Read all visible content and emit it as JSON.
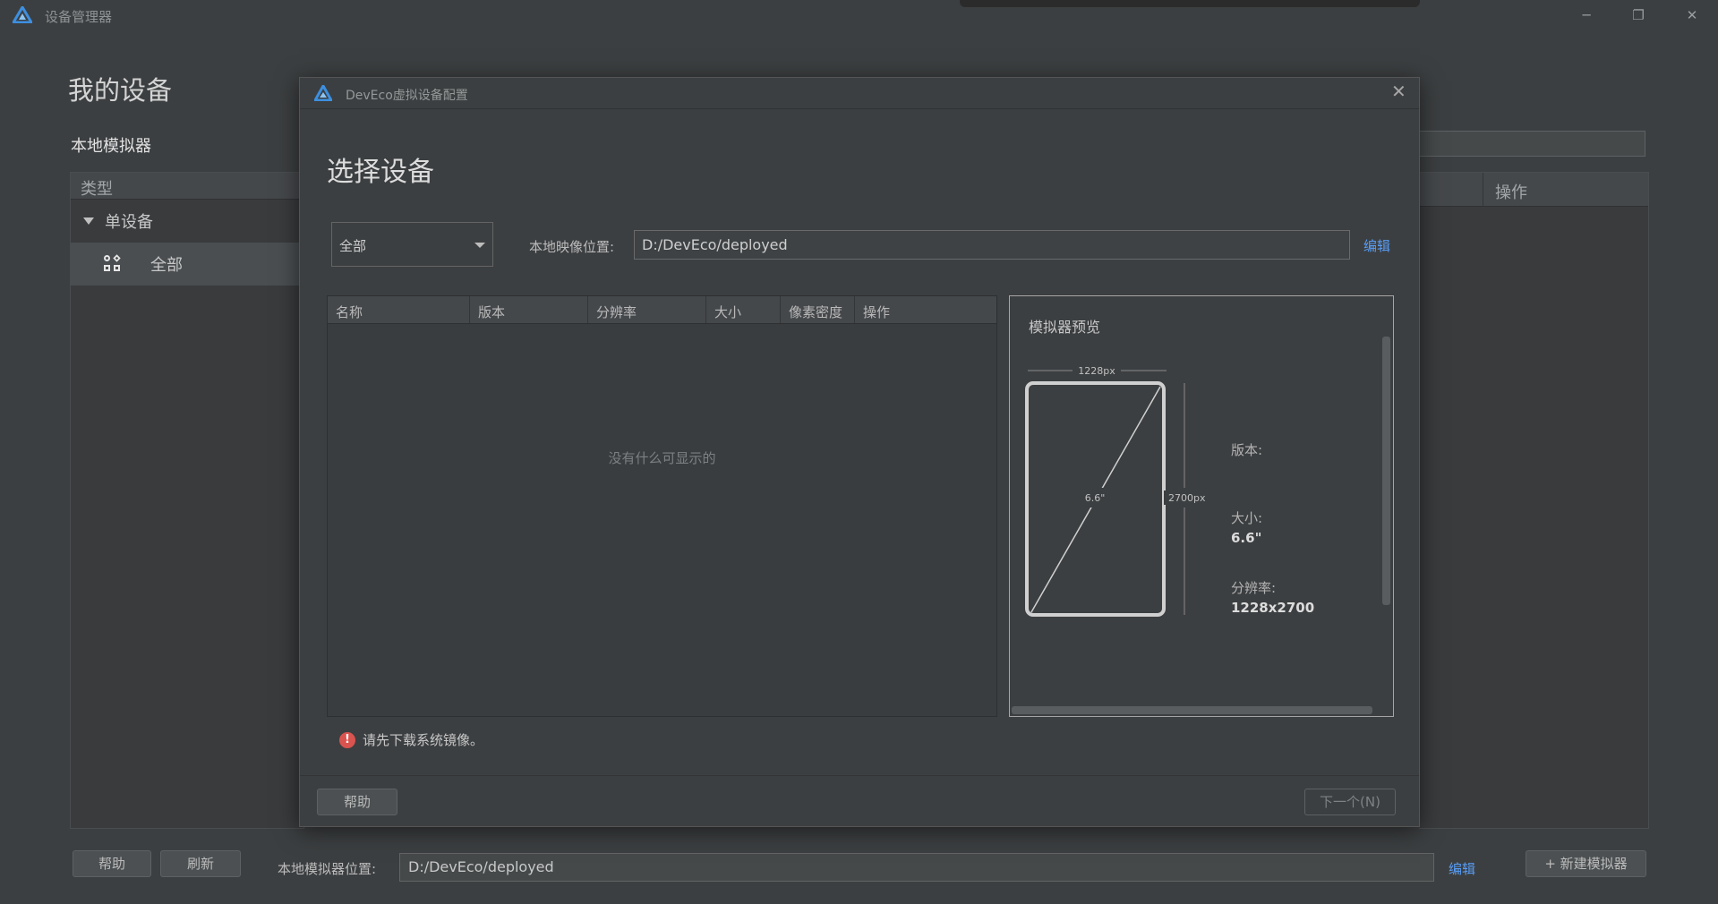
{
  "window": {
    "title": "设备管理器",
    "minimize_icon": "─",
    "maximize_icon": "❐",
    "close_icon": "✕"
  },
  "main": {
    "page_title": "我的设备",
    "section_label": "本地模拟器",
    "tree": {
      "header": "类型",
      "group": "单设备",
      "item": "全部"
    },
    "table_right_header": "操作",
    "bottom": {
      "help_label": "帮助",
      "refresh_label": "刷新",
      "location_label": "本地模拟器位置:",
      "location_value": "D:/DevEco/deployed",
      "edit_label": "编辑",
      "new_emulator_label": "+ 新建模拟器"
    }
  },
  "dialog": {
    "title": "DevEco虚拟设备配置",
    "close_icon": "✕",
    "heading": "选择设备",
    "filter_select": {
      "value": "全部"
    },
    "image_location_label": "本地映像位置:",
    "image_location_value": "D:/DevEco/deployed",
    "edit_label": "编辑",
    "table": {
      "columns": [
        {
          "label": "名称"
        },
        {
          "label": "版本"
        },
        {
          "label": "分辨率"
        },
        {
          "label": "大小"
        },
        {
          "label": "像素密度"
        },
        {
          "label": "操作"
        }
      ],
      "empty_text": "没有什么可显示的"
    },
    "preview": {
      "title": "模拟器预览",
      "width_label": "1228px",
      "height_label": "2700px",
      "diagonal_label": "6.6\"",
      "version_label": "版本:",
      "size_label": "大小:",
      "size_value": "6.6\"",
      "resolution_label": "分辨率:",
      "resolution_value": "1228x2700"
    },
    "warning_icon": "!",
    "warning_text": "请先下载系统镜像。",
    "help_label": "帮助",
    "next_label": "下一个(N)"
  },
  "colors": {
    "background": "#3c3f41",
    "link": "#589df6",
    "warning": "#d9534f",
    "logo_blue": "#3d8fe0"
  }
}
